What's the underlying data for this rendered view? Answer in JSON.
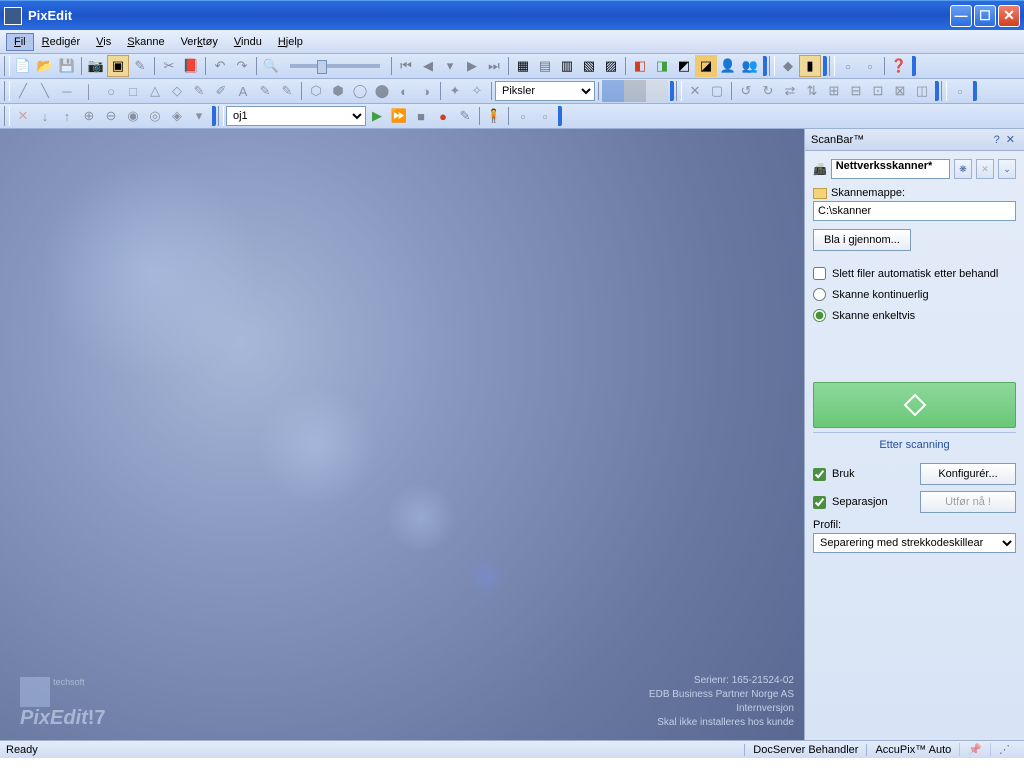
{
  "window": {
    "title": "PixEdit"
  },
  "menu": {
    "fil": "Fil",
    "rediger": "Redigér",
    "vis": "Vis",
    "skanne": "Skanne",
    "verktoy": "Verktøy",
    "vindu": "Vindu",
    "hjelp": "Hjelp"
  },
  "toolbar": {
    "units_combo": "Piksler",
    "file_combo": "oj1"
  },
  "scanbar": {
    "title": "ScanBar™",
    "scanner": "Nettverksskanner*",
    "folder_label": "Skannemappe:",
    "folder_value": "C:\\skanner",
    "browse": "Bla i gjennom...",
    "auto_delete": "Slett filer automatisk etter behandl",
    "scan_continuous": "Skanne kontinuerlig",
    "scan_single": "Skanne enkeltvis",
    "after_scan": "Etter scanning",
    "use": "Bruk",
    "configure": "Konfigurér...",
    "separation": "Separasjon",
    "run_now": "Utfør nå !",
    "profile_label": "Profil:",
    "profile_value": "Separering med strekkodeskillear"
  },
  "canvas": {
    "serial": "Serienr: 165-21524-02",
    "company": "EDB Business Partner Norge AS",
    "version": "Internversjon",
    "warning": "Skal ikke installeres hos kunde",
    "brand_small": "techsoft",
    "brand": "PixEdit",
    "brand_ver": "7"
  },
  "status": {
    "ready": "Ready",
    "docserver": "DocServer Behandler",
    "accupix": "AccuPix™ Auto"
  }
}
